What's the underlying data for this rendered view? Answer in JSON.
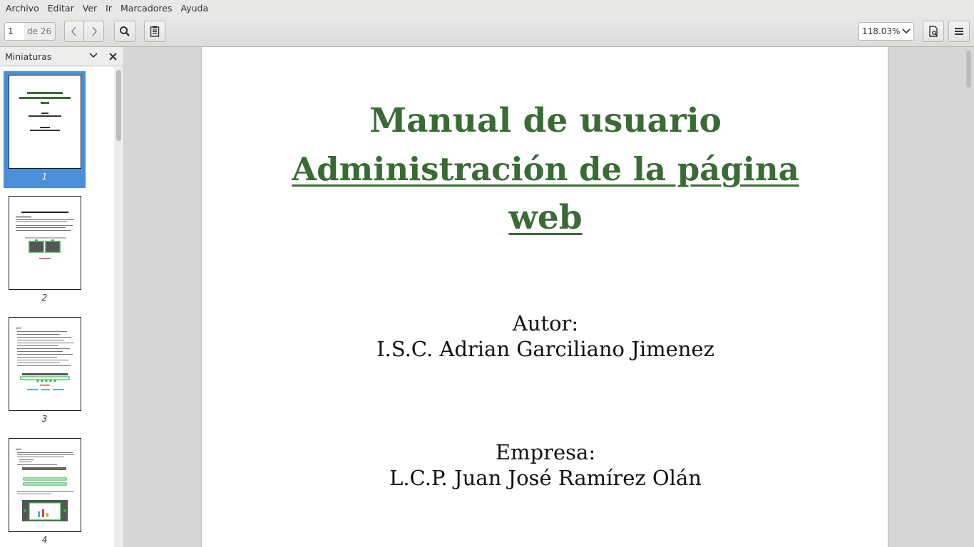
{
  "menubar": {
    "items": [
      "Archivo",
      "Editar",
      "Ver",
      "Ir",
      "Marcadores",
      "Ayuda"
    ]
  },
  "toolbar": {
    "page_current": "1",
    "page_count_label": "de 26",
    "prev_icon": "chevron-left-icon",
    "next_icon": "chevron-right-icon",
    "search_icon": "search-icon",
    "annotations_icon": "clipboard-icon",
    "zoom_value": "118.03%",
    "document_icon": "document-properties-icon",
    "menu_icon": "hamburger-menu-icon"
  },
  "sidebar": {
    "title": "Miniaturas",
    "thumbnails": [
      {
        "number": "1",
        "selected": true
      },
      {
        "number": "2",
        "selected": false
      },
      {
        "number": "3",
        "selected": false
      },
      {
        "number": "4",
        "selected": false
      }
    ]
  },
  "document": {
    "title_line1": "Manual de usuario",
    "title_line2": "Administración de la página",
    "title_line3": "web",
    "author_label": "Autor:",
    "author_name": "I.S.C. Adrian Garciliano Jimenez",
    "company_label": "Empresa:",
    "company_name": "L.C.P. Juan José Ramírez Olán",
    "title_color": "#3a6b35"
  },
  "colors": {
    "selection": "#4a90d9",
    "title_green": "#3a6b35"
  }
}
